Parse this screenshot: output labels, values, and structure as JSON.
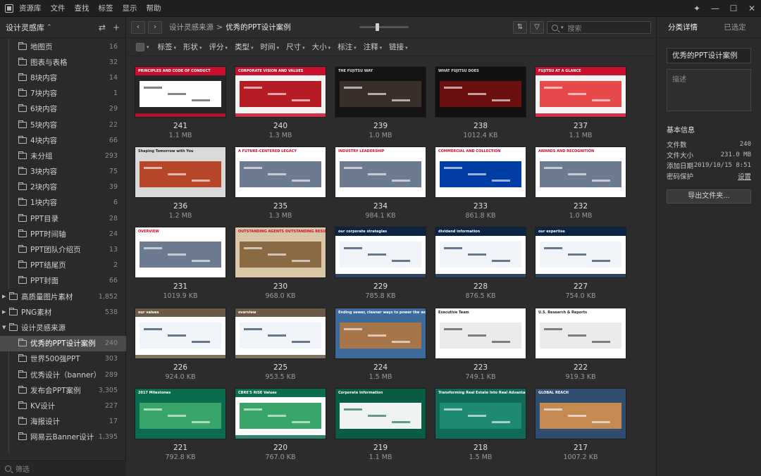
{
  "menu": [
    "资源库",
    "文件",
    "查找",
    "标签",
    "显示",
    "帮助"
  ],
  "window_controls": {
    "pin": "✦",
    "minimize": "—",
    "maximize": "☐",
    "close": "✕"
  },
  "sidebar": {
    "title": "设计灵感库",
    "title_caret": "⌃",
    "sort_glyph": "⇄",
    "add_glyph": "+",
    "filter_placeholder": "筛选",
    "items": [
      {
        "label": "地图页",
        "count": "16",
        "level": 1,
        "expander": ""
      },
      {
        "label": "图表与表格",
        "count": "32",
        "level": 1,
        "expander": ""
      },
      {
        "label": "8块内容",
        "count": "14",
        "level": 1,
        "expander": ""
      },
      {
        "label": "7块内容",
        "count": "1",
        "level": 1,
        "expander": ""
      },
      {
        "label": "6块内容",
        "count": "29",
        "level": 1,
        "expander": ""
      },
      {
        "label": "5块内容",
        "count": "22",
        "level": 1,
        "expander": ""
      },
      {
        "label": "4块内容",
        "count": "66",
        "level": 1,
        "expander": ""
      },
      {
        "label": "未分组",
        "count": "293",
        "level": 1,
        "expander": ""
      },
      {
        "label": "3块内容",
        "count": "75",
        "level": 1,
        "expander": ""
      },
      {
        "label": "2块内容",
        "count": "39",
        "level": 1,
        "expander": ""
      },
      {
        "label": "1块内容",
        "count": "6",
        "level": 1,
        "expander": ""
      },
      {
        "label": "PPT目录",
        "count": "28",
        "level": 1,
        "expander": ""
      },
      {
        "label": "PPT时间轴",
        "count": "24",
        "level": 1,
        "expander": ""
      },
      {
        "label": "PPT团队介绍页",
        "count": "13",
        "level": 1,
        "expander": ""
      },
      {
        "label": "PPT结尾页",
        "count": "2",
        "level": 1,
        "expander": ""
      },
      {
        "label": "PPT封面",
        "count": "66",
        "level": 1,
        "expander": ""
      },
      {
        "label": "高质量图片素材",
        "count": "1,852",
        "level": 0,
        "expander": "▶"
      },
      {
        "label": "PNG素材",
        "count": "538",
        "level": 0,
        "expander": "▶"
      },
      {
        "label": "设计灵感来源",
        "count": "",
        "level": 0,
        "expander": "▼"
      },
      {
        "label": "优秀的PPT设计案例",
        "count": "240",
        "level": 1,
        "expander": "",
        "selected": true
      },
      {
        "label": "世界500强PPT",
        "count": "303",
        "level": 1,
        "expander": ""
      },
      {
        "label": "优秀设计（banner）",
        "count": "289",
        "level": 1,
        "expander": ""
      },
      {
        "label": "发布会PPT案例",
        "count": "3,305",
        "level": 1,
        "expander": ""
      },
      {
        "label": "KV设计",
        "count": "227",
        "level": 1,
        "expander": ""
      },
      {
        "label": "海报设计",
        "count": "17",
        "level": 1,
        "expander": ""
      },
      {
        "label": "网易云Banner设计",
        "count": "1,395",
        "level": 1,
        "expander": ""
      }
    ]
  },
  "toolbar": {
    "back": "‹",
    "forward": "›",
    "breadcrumb_parent": "设计灵感来源",
    "breadcrumb_sep": ">",
    "breadcrumb_current": "优秀的PPT设计案例",
    "zoom_level": 0.35,
    "sort_glyph": "⇅",
    "filter_glyph": "▽",
    "search_placeholder": "搜索"
  },
  "filters": [
    "标签",
    "形状",
    "评分",
    "类型",
    "时间",
    "尺寸",
    "大小",
    "标注",
    "注释",
    "链接"
  ],
  "dropdown_glyph": "▾",
  "items": [
    {
      "num": "241",
      "size": "1.1 MB",
      "style": "dark-red",
      "caption": "PRINCIPLES AND CODE OF CONDUCT"
    },
    {
      "num": "240",
      "size": "1.3 MB",
      "style": "red-photo",
      "caption": "CORPORATE VISION AND VALUES"
    },
    {
      "num": "239",
      "size": "1.0 MB",
      "style": "dark-people",
      "caption": "THE FUJITSU WAY"
    },
    {
      "num": "238",
      "size": "1012.4 KB",
      "style": "dark-server",
      "caption": "WHAT FUJITSU DOES"
    },
    {
      "num": "237",
      "size": "1.1 MB",
      "style": "light-red",
      "caption": "FUJITSU AT A GLANCE"
    },
    {
      "num": "236",
      "size": "1.2 MB",
      "style": "fujitsu-cover",
      "caption": "Shaping Tomorrow with You"
    },
    {
      "num": "235",
      "size": "1.3 MB",
      "style": "white-red",
      "caption": "A FUTURE-CENTERED LEGACY"
    },
    {
      "num": "234",
      "size": "984.1 KB",
      "style": "white-red",
      "caption": "INDUSTRY LEADERSHIP"
    },
    {
      "num": "233",
      "size": "861.8 KB",
      "style": "remax",
      "caption": "COMMERCIAL AND COLLECTION"
    },
    {
      "num": "232",
      "size": "1.0 MB",
      "style": "white-red",
      "caption": "AWARDS AND RECOGNITION"
    },
    {
      "num": "231",
      "size": "1019.9 KB",
      "style": "white-red",
      "caption": "OVERVIEW"
    },
    {
      "num": "230",
      "size": "968.0 KB",
      "style": "balloon",
      "caption": "OUTSTANDING AGENTS OUTSTANDING RESULTS"
    },
    {
      "num": "229",
      "size": "785.8 KB",
      "style": "navy",
      "caption": "our corporate strategies"
    },
    {
      "num": "228",
      "size": "876.5 KB",
      "style": "navy",
      "caption": "dividend information"
    },
    {
      "num": "227",
      "size": "754.0 KB",
      "style": "navy",
      "caption": "our expertise"
    },
    {
      "num": "226",
      "size": "924.0 KB",
      "style": "navy-light",
      "caption": "our values"
    },
    {
      "num": "225",
      "size": "953.5 KB",
      "style": "navy-light",
      "caption": "overview"
    },
    {
      "num": "224",
      "size": "1.5 MB",
      "style": "aerial",
      "caption": "Ending sewer, cleaner ways to power the world"
    },
    {
      "num": "223",
      "size": "749.1 KB",
      "style": "white-plain",
      "caption": "Executive Team"
    },
    {
      "num": "222",
      "size": "919.3 KB",
      "style": "white-plain",
      "caption": "U.S. Research & Reports"
    },
    {
      "num": "221",
      "size": "792.8 KB",
      "style": "green",
      "caption": "2017 Milestones"
    },
    {
      "num": "220",
      "size": "767.0 KB",
      "style": "green-white",
      "caption": "CBRE'S RISE Values"
    },
    {
      "num": "219",
      "size": "1.1 MB",
      "style": "green-building",
      "caption": "Corporate Information"
    },
    {
      "num": "218",
      "size": "1.5 MB",
      "style": "green-glass",
      "caption": "Transforming Real Estate Into Real Advantage"
    },
    {
      "num": "217",
      "size": "1007.2 KB",
      "style": "jets",
      "caption": "GLOBAL REACH"
    }
  ],
  "panel": {
    "tab_details": "分类详情",
    "tab_selected": "已选定",
    "name": "优秀的PPT设计案例",
    "desc_placeholder": "描述",
    "section": "基本信息",
    "rows": [
      {
        "key": "文件数",
        "val": "240"
      },
      {
        "key": "文件大小",
        "val": "231.0 MB"
      },
      {
        "key": "添加日期",
        "val": "2019/10/15 8:51"
      },
      {
        "key": "密码保护",
        "val": "设置"
      }
    ],
    "export_button": "导出文件夹..."
  }
}
